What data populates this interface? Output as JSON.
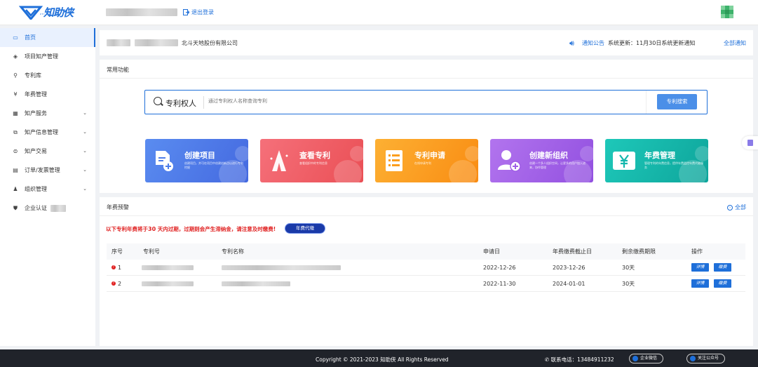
{
  "header": {
    "logo_text": "知助侠",
    "logo_sub": "ZHIZHUXIA",
    "logout": "退出登录"
  },
  "sidebar": {
    "items": [
      {
        "label": "首页",
        "icon": "home-icon"
      },
      {
        "label": "项目知产管理",
        "icon": "layers-icon"
      },
      {
        "label": "专利库",
        "icon": "patent-icon"
      },
      {
        "label": "年费管理",
        "icon": "yen-icon"
      },
      {
        "label": "知产服务",
        "icon": "grid-icon"
      },
      {
        "label": "知产信息管理",
        "icon": "copy-icon"
      },
      {
        "label": "知产交易",
        "icon": "trade-icon"
      },
      {
        "label": "订单/发票管理",
        "icon": "clipboard-icon"
      },
      {
        "label": "组织管理",
        "icon": "team-icon"
      },
      {
        "label": "企业认证",
        "icon": "shield-icon"
      }
    ]
  },
  "company": {
    "name": "北斗天地股份有限公司"
  },
  "notice": {
    "label": "通知公告",
    "text": "系统更新：11月30日系统更新通知",
    "all": "全部通知"
  },
  "common": {
    "title": "常用功能",
    "search_type": "专利权人",
    "search_placeholder": "通过专利权人名称查询专利",
    "search_button": "专利搜索"
  },
  "cards": [
    {
      "title": "创建项目",
      "desc": "创建项目，并可在项目中创建创新点以进行专利挖掘",
      "color": "#4f7ee9"
    },
    {
      "title": "查看专利",
      "desc": "查看组织中的专利信息",
      "color": "#f05a5f"
    },
    {
      "title": "专利申请",
      "desc": "在线申请专利",
      "color": "#fb9e1e"
    },
    {
      "title": "创建新组织",
      "desc": "创建一个多人组织空间，让更多的用户加入进来，协作管理",
      "color": "#a05fe6"
    },
    {
      "title": "年费管理",
      "desc": "管理专利的年费信息，提供年费监控年费代缴服务",
      "color": "#13b7ad"
    }
  ],
  "fees": {
    "title": "年费预警",
    "all": "全部",
    "warning_pre": "以下专利年费将于",
    "warning_days": "30",
    "warning_post": "天内过期，过期则会产生滞纳金，请注意及时缴费!",
    "agent_button": "年费代缴",
    "columns": [
      "序号",
      "专利号",
      "专利名称",
      "申请日",
      "年费缴费截止日",
      "剩余缴费期限",
      "操作"
    ],
    "rows": [
      {
        "no": "1",
        "apply_date": "2022-12-26",
        "deadline": "2023-12-26",
        "remaining": "30天"
      },
      {
        "no": "2",
        "apply_date": "2022-11-30",
        "deadline": "2024-01-01",
        "remaining": "30天"
      }
    ],
    "detail_label": "详情",
    "pay_label": "缴费"
  },
  "footer": {
    "copyright": "Copyright © 2021-2023 知助侠 All Rights Reserved",
    "phone": "联系电话：13484911232",
    "wechat": "企业微信",
    "follow": "关注公众号"
  }
}
